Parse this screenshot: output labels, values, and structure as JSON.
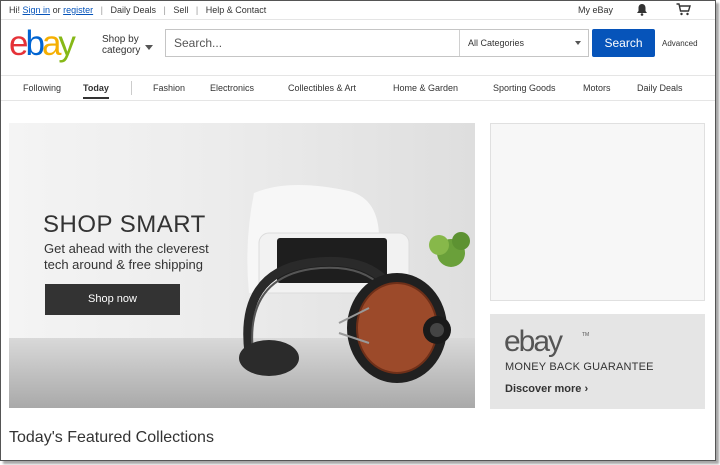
{
  "topbar": {
    "greeting": "Hi!",
    "sign_in": "Sign in",
    "or": "or",
    "register": "register",
    "links": [
      "Daily Deals",
      "Sell",
      "Help & Contact"
    ],
    "my_ebay": "My eBay"
  },
  "header": {
    "logo_letters": [
      "e",
      "b",
      "a",
      "y"
    ],
    "logo_colors": [
      "#e53238",
      "#0064d2",
      "#f5af02",
      "#86b817"
    ],
    "shop_by_line1": "Shop by",
    "shop_by_line2": "category",
    "search_placeholder": "Search...",
    "category_selected": "All Categories",
    "search_button": "Search",
    "advanced": "Advanced"
  },
  "catnav": {
    "items": [
      "Following",
      "Today",
      "Fashion",
      "Electronics",
      "Collectibles & Art",
      "Home & Garden",
      "Sporting Goods",
      "Motors",
      "Daily Deals"
    ],
    "active": "Today"
  },
  "hero": {
    "title": "SHOP SMART",
    "subtitle_line1": "Get ahead with the cleverest",
    "subtitle_line2": "tech around & free shipping",
    "cta": "Shop now"
  },
  "guarantee": {
    "logo": "ebay",
    "trademark": "TM",
    "label": "MONEY BACK GUARANTEE",
    "link": "Discover more ›"
  },
  "featured_heading": "Today's Featured Collections",
  "icons": {
    "bell": "bell-icon",
    "cart": "cart-icon",
    "chevron": "chevron-down-icon"
  }
}
